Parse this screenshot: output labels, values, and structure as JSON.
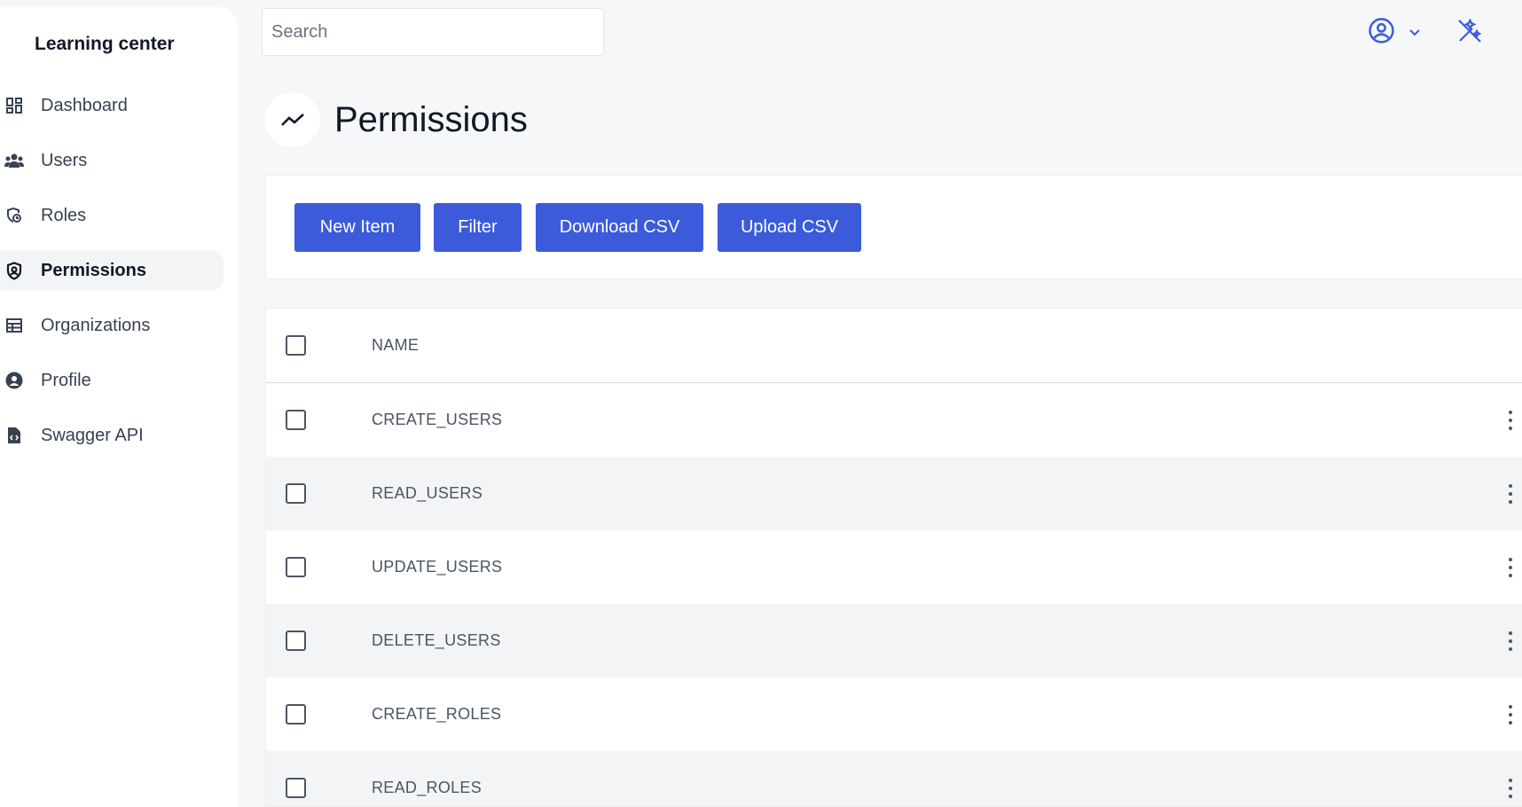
{
  "app": {
    "brand": "Learning center"
  },
  "sidebar": {
    "items": [
      {
        "label": "Dashboard",
        "icon": "dashboard-icon"
      },
      {
        "label": "Users",
        "icon": "users-icon"
      },
      {
        "label": "Roles",
        "icon": "roles-icon"
      },
      {
        "label": "Permissions",
        "icon": "shield-icon",
        "active": true
      },
      {
        "label": "Organizations",
        "icon": "table-icon"
      },
      {
        "label": "Profile",
        "icon": "user-circle-icon"
      },
      {
        "label": "Swagger API",
        "icon": "file-code-icon"
      }
    ]
  },
  "header": {
    "search_placeholder": "Search",
    "icons": [
      "account-icon",
      "chevron-down-icon",
      "theme-toggle-icon"
    ]
  },
  "page": {
    "title": "Permissions",
    "title_icon": "trend-icon"
  },
  "toolbar": {
    "new_item": "New Item",
    "filter": "Filter",
    "download_csv": "Download CSV",
    "upload_csv": "Upload CSV"
  },
  "table": {
    "header": "NAME",
    "rows": [
      "CREATE_USERS",
      "READ_USERS",
      "UPDATE_USERS",
      "DELETE_USERS",
      "CREATE_ROLES",
      "READ_ROLES"
    ]
  },
  "colors": {
    "primary": "#3b5bdb",
    "background": "#f6f7f9",
    "row_alt": "#f3f4f6"
  }
}
